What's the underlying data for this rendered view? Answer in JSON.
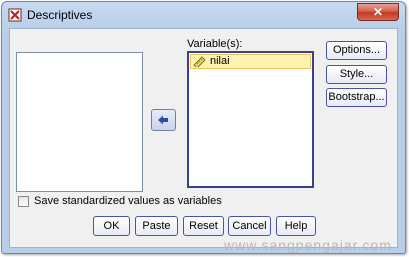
{
  "window": {
    "title": "Descriptives",
    "close_glyph": "✕"
  },
  "variables_label": "Variable(s):",
  "selected_variables": [
    {
      "name": "nilai",
      "icon": "scale-ruler-icon"
    }
  ],
  "side_buttons": {
    "options": "Options...",
    "style": "Style...",
    "bootstrap": "Bootstrap..."
  },
  "checkbox": {
    "label": "Save standardized values as variables",
    "checked": false
  },
  "buttons": {
    "ok": "OK",
    "paste": "Paste",
    "reset": "Reset",
    "cancel": "Cancel",
    "help": "Help"
  },
  "watermark": "www.sangpengajar.com"
}
